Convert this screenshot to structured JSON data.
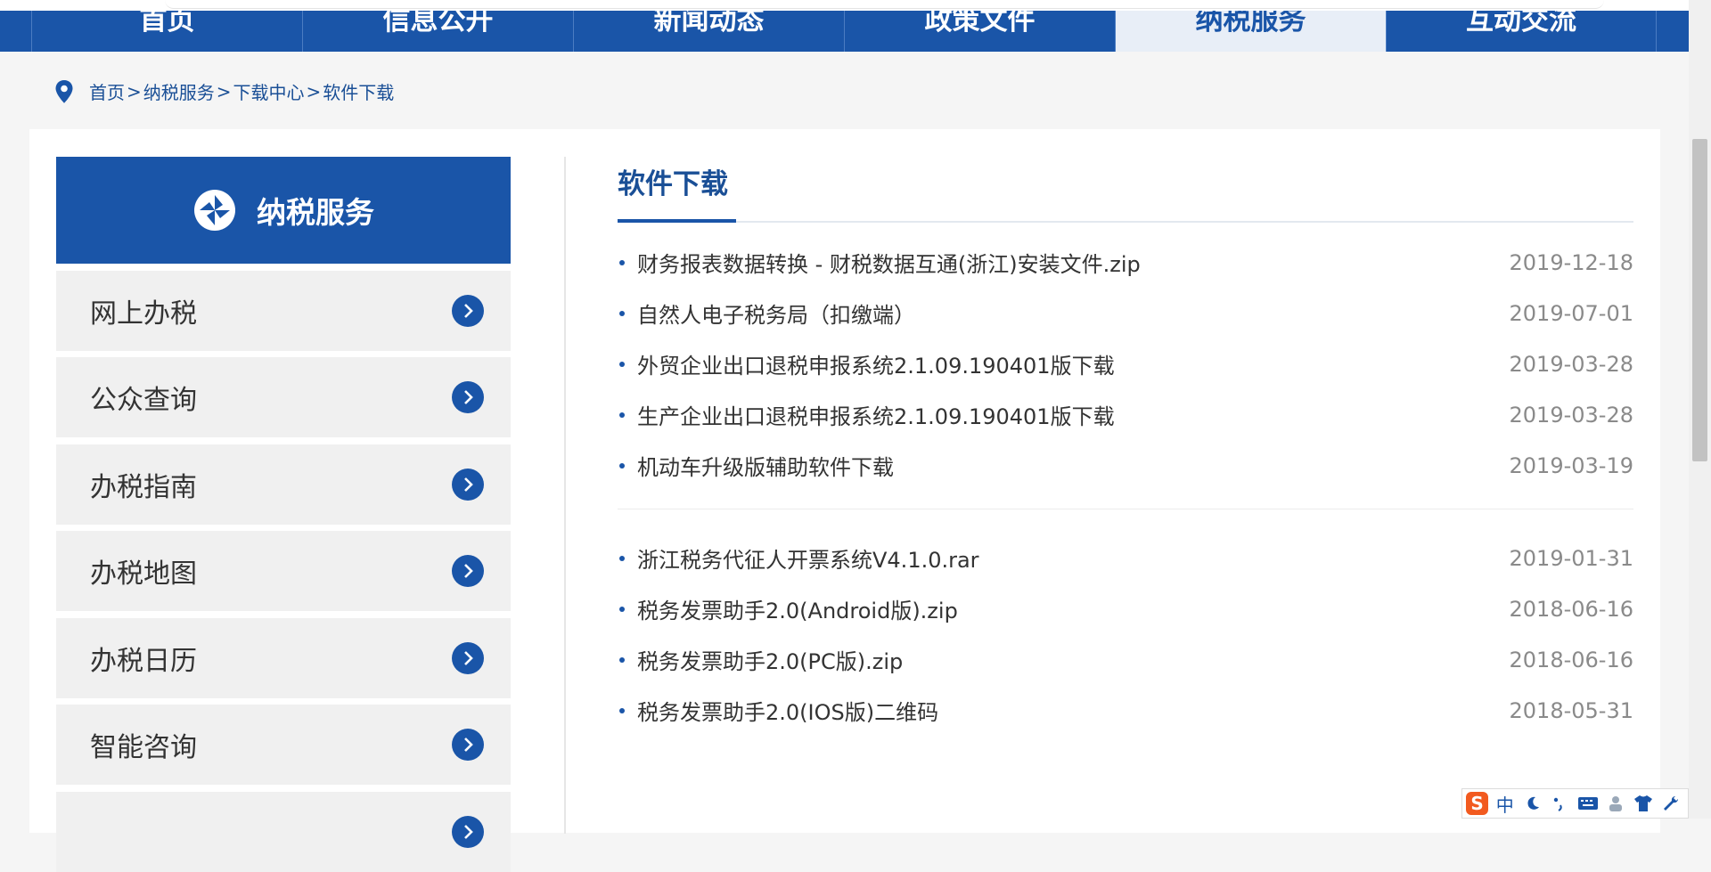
{
  "nav": {
    "items": [
      "首页",
      "信息公开",
      "新闻动态",
      "政策文件",
      "纳税服务",
      "互动交流"
    ],
    "active_index": 4
  },
  "breadcrumb": {
    "items": [
      "首页",
      "纳税服务",
      "下载中心",
      "软件下载"
    ],
    "separator": ">"
  },
  "sidebar": {
    "title": "纳税服务",
    "items": [
      {
        "label": "网上办税"
      },
      {
        "label": "公众查询"
      },
      {
        "label": "办税指南"
      },
      {
        "label": "办税地图"
      },
      {
        "label": "办税日历"
      },
      {
        "label": "智能咨询"
      }
    ]
  },
  "content": {
    "title": "软件下载",
    "group1": [
      {
        "name": "财务报表数据转换 - 财税数据互通(浙江)安装文件.zip",
        "date": "2019-12-18"
      },
      {
        "name": "自然人电子税务局（扣缴端）",
        "date": "2019-07-01"
      },
      {
        "name": "外贸企业出口退税申报系统2.1.09.190401版下载",
        "date": "2019-03-28"
      },
      {
        "name": "生产企业出口退税申报系统2.1.09.190401版下载",
        "date": "2019-03-28"
      },
      {
        "name": "机动车升级版辅助软件下载",
        "date": "2019-03-19"
      }
    ],
    "group2": [
      {
        "name": "浙江税务代征人开票系统V4.1.0.rar",
        "date": "2019-01-31"
      },
      {
        "name": "税务发票助手2.0(Android版).zip",
        "date": "2018-06-16"
      },
      {
        "name": "税务发票助手2.0(PC版).zip",
        "date": "2018-06-16"
      },
      {
        "name": "税务发票助手2.0(IOS版)二维码",
        "date": "2018-05-31"
      }
    ]
  },
  "ime": {
    "logo": "S",
    "mode": "中",
    "icons": [
      "moon-icon",
      "punctuation-icon",
      "keyboard-icon",
      "user-icon",
      "shirt-icon",
      "wrench-icon"
    ]
  },
  "colors": {
    "brand_blue": "#1a55a8",
    "nav_active_bg": "#e8eef7",
    "date_gray": "#8a8a8a"
  }
}
